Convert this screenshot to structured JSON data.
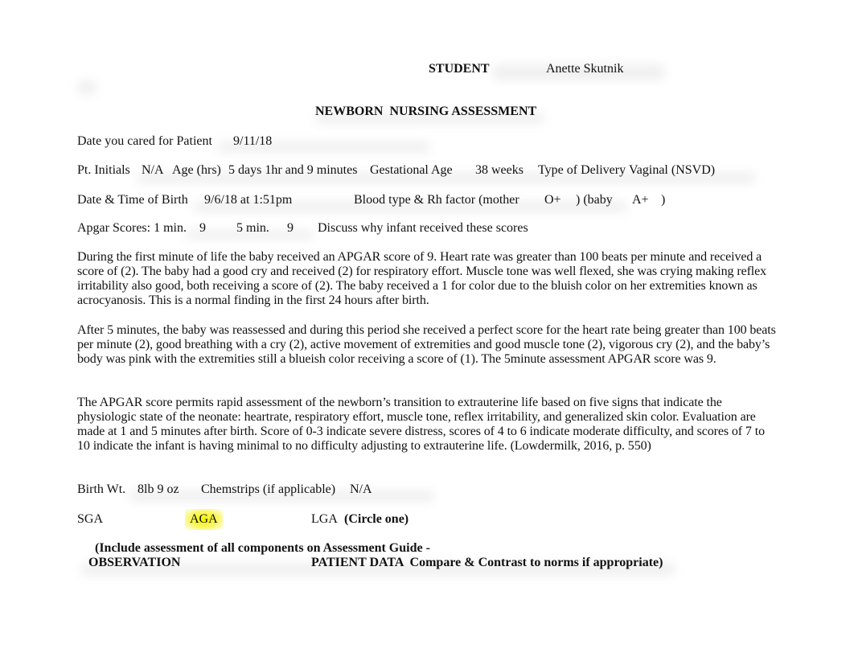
{
  "header": {
    "student_label": "STUDENT",
    "student_name": "Anette Skutnik",
    "title": "NEWBORN  NURSING ASSESSMENT"
  },
  "fields": {
    "date_cared_label": "Date you cared for Patient",
    "date_cared_value": "9/11/18",
    "initials_label": "Pt. Initials",
    "initials_value": "N/A",
    "age_label": "Age (hrs)",
    "age_value": "5 days 1hr and 9 minutes",
    "gest_label": "Gestational Age",
    "gest_value": "38 weeks",
    "delivery_label": "Type of Delivery",
    "delivery_value": "Vaginal (NSVD)",
    "birth_label": "Date & Time of Birth",
    "birth_value": "9/6/18 at 1:51pm",
    "blood_label": "Blood type & Rh factor (mother",
    "mother_value": "O+",
    "baby_label": ") (baby",
    "baby_value": "A+",
    "close_paren": ")",
    "apgar_label": "Apgar Scores: 1 min.",
    "apgar_1": "9",
    "apgar_5_label": "5 min.",
    "apgar_5": "9",
    "discuss_label": "Discuss why infant received these scores"
  },
  "paragraphs": [
    "During the first minute of life the baby received an APGAR score of 9. Heart rate was greater than 100 beats per minute and received a score of (2). The baby had a good cry and received (2) for respiratory effort. Muscle tone was well flexed, she was crying making reflex irritability also good, both receiving a score of (2). The baby received a 1 for color due to the bluish color on her extremities known as acrocyanosis. This is a normal finding in the first 24 hours after birth.",
    "After 5 minutes, the baby was reassessed and during this period she received a perfect score for the heart rate being greater than 100 beats per minute (2), good breathing with a cry (2), active movement of extremities and good muscle tone (2), vigorous cry (2), and the baby’s body was pink with the extremities still a blueish color receiving a score of (1). The 5minute assessment APGAR score was 9.",
    "The APGAR score permits rapid assessment of the newborn’s transition to extrauterine life based on five signs that indicate the physiologic state of the neonate: heartrate, respiratory effort, muscle tone, reflex irritability, and generalized skin color. Evaluation are made at 1 and 5 minutes after birth. Score of 0-3 indicate severe distress, scores of 4 to 6 indicate moderate difficulty, and scores of 7 to 10 indicate the infant is having minimal to no difficulty adjusting to extrauterine life. (Lowdermilk, 2016, p. 550)"
  ],
  "weight": {
    "birth_wt_label": "Birth Wt.",
    "birth_wt_value": "8lb 9 oz",
    "chemstrips_label": "Chemstrips (if applicable)",
    "chemstrips_value": "N/A"
  },
  "size_class": {
    "sga": "SGA",
    "aga": "AGA",
    "lga": "LGA",
    "instruction": "(Circle one)",
    "selected": "AGA",
    "highlight_color": "#f7f200"
  },
  "footer": {
    "include_note": "(Include assessment of all components on Assessment Guide -",
    "observation": "OBSERVATION",
    "patient_data": "PATIENT DATA  Compare & Contrast to norms if appropriate)"
  }
}
